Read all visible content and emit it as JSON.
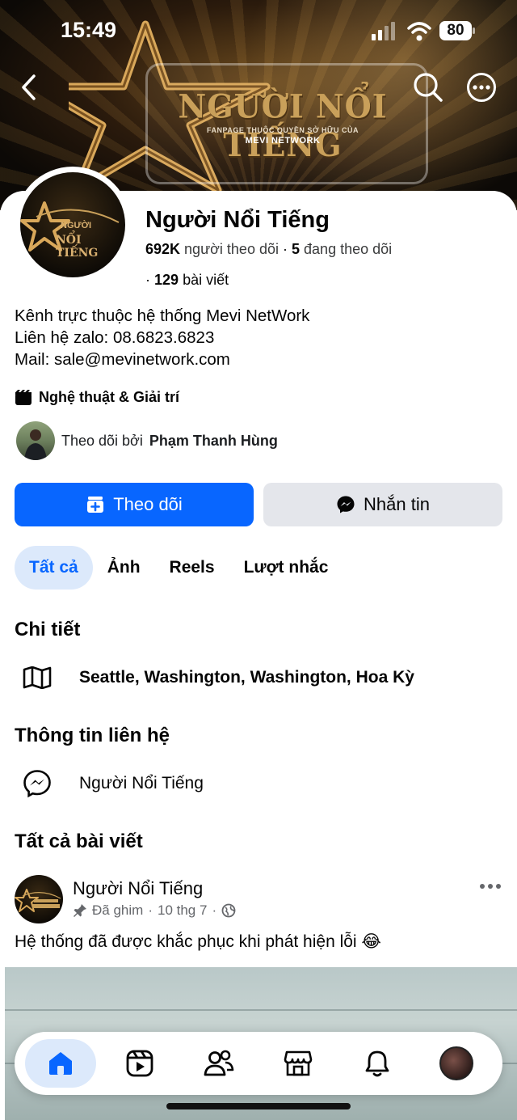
{
  "status_bar": {
    "time": "15:49",
    "battery": "80"
  },
  "cover": {
    "title": "NGƯỜI NỔI TIẾNG",
    "subtitle": "FANPAGE THUỘC QUYỀN SỞ HỮU CỦA",
    "network": "MEVI NETWORK",
    "accent_color": "#c9a05a"
  },
  "avatar_logo": {
    "line1": "NGƯỜI",
    "line2": "NỔI TIẾNG"
  },
  "profile": {
    "name": "Người Nổi Tiếng",
    "followers_count": "692K",
    "followers_label": "người theo dõi",
    "following_count": "5",
    "following_label": "đang theo dõi",
    "posts_count": "129",
    "posts_label": "bài viết",
    "bio": [
      "Kênh trực thuộc hệ thống Mevi NetWork",
      "Liên hệ zalo: 08.6823.6823",
      "Mail: sale@mevinetwork.com"
    ],
    "category": "Nghệ thuật & Giải trí",
    "followed_by_prefix": "Theo dõi bởi",
    "followed_by_name": "Phạm Thanh Hùng"
  },
  "actions": {
    "follow_label": "Theo dõi",
    "message_label": "Nhắn tin",
    "primary_color": "#0866ff"
  },
  "tabs": [
    {
      "label": "Tất cả",
      "active": true
    },
    {
      "label": "Ảnh",
      "active": false
    },
    {
      "label": "Reels",
      "active": false
    },
    {
      "label": "Lượt nhắc",
      "active": false
    }
  ],
  "details": {
    "title": "Chi tiết",
    "location": "Seattle, Washington, Washington, Hoa Kỳ",
    "icon": "map-icon"
  },
  "contact": {
    "title": "Thông tin liên hệ",
    "messenger": "Người Nổi Tiếng",
    "icon": "messenger-icon"
  },
  "posts": {
    "title": "Tất cả bài viết",
    "items": [
      {
        "author": "Người Nổi Tiếng",
        "pinned_label": "Đã ghim",
        "date": "10 thg 7",
        "text": "Hệ thống đã được khắc phục khi phát hiện lỗi 😂"
      }
    ]
  },
  "bottom_nav": [
    "home-icon",
    "reels-icon",
    "friends-icon",
    "marketplace-icon",
    "notifications-icon",
    "profile-avatar"
  ]
}
